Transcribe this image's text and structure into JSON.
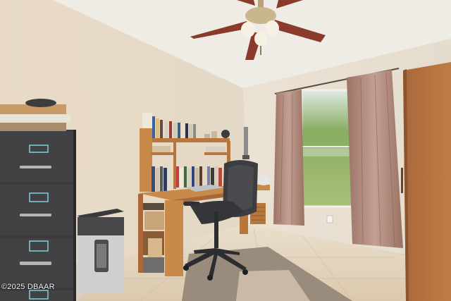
{
  "photo": {
    "description_tags": [
      "home-office",
      "ceiling-fan",
      "filing-cabinet",
      "paper-shredder",
      "desk-with-hutch",
      "office-chair",
      "window-with-curtains",
      "wardrobe",
      "tile-floor",
      "area-rug"
    ],
    "colors": {
      "wall": "#e6dccb",
      "ceiling": "#efece6",
      "floor": "#e2d3bd",
      "rug": "#9a8c7c",
      "cabinet": "#3a3a3c",
      "desk_wood": "#c88a4a",
      "curtain": "#b08a7c",
      "wardrobe": "#b5703e",
      "chair": "#3c3d40",
      "window_green": "#7fa35a"
    }
  },
  "watermark": {
    "text": "©2025 DBAAR"
  }
}
